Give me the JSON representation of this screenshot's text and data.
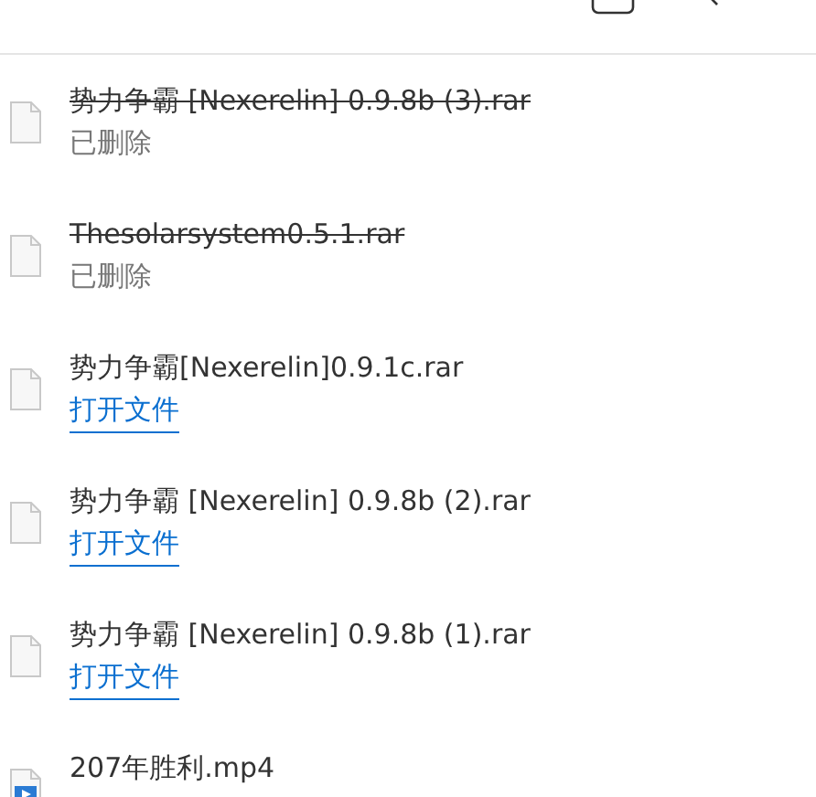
{
  "downloads": [
    {
      "name": "势力争霸 [Nexerelin] 0.9.8b (3).rar",
      "deleted": true,
      "status": "已删除",
      "kind": "file"
    },
    {
      "name": "Thesolarsystem0.5.1.rar",
      "deleted": true,
      "status": "已删除",
      "kind": "file"
    },
    {
      "name": "势力争霸[Nexerelin]0.9.1c.rar",
      "deleted": false,
      "status": "打开文件",
      "kind": "file"
    },
    {
      "name": "势力争霸 [Nexerelin] 0.9.8b (2).rar",
      "deleted": false,
      "status": "打开文件",
      "kind": "file"
    },
    {
      "name": "势力争霸 [Nexerelin] 0.9.8b (1).rar",
      "deleted": false,
      "status": "打开文件",
      "kind": "file"
    },
    {
      "name": "207年胜利.mp4",
      "deleted": false,
      "kind": "video"
    }
  ]
}
